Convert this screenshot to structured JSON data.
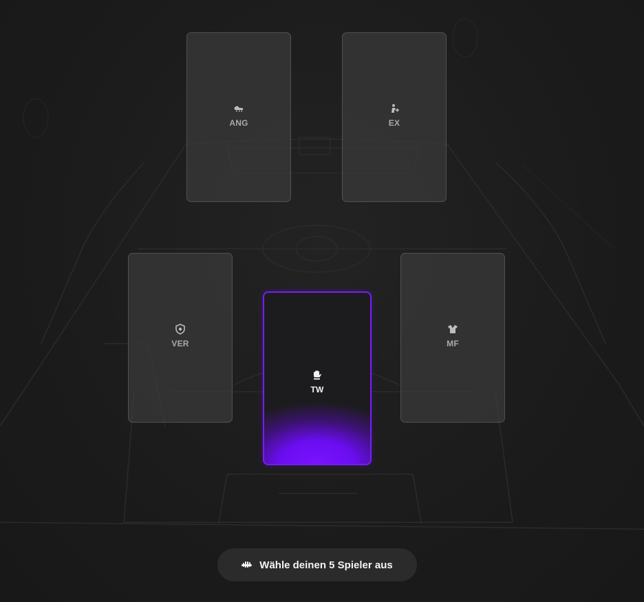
{
  "positions": {
    "ang": {
      "label": "ANG",
      "icon": "cleat-icon"
    },
    "ex": {
      "label": "EX",
      "icon": "player-plus-icon"
    },
    "ver": {
      "label": "VER",
      "icon": "shield-icon"
    },
    "tw": {
      "label": "TW",
      "icon": "glove-icon",
      "selected": true
    },
    "mf": {
      "label": "MF",
      "icon": "jersey-icon"
    }
  },
  "cta": {
    "label": "Wähle deinen 5 Spieler aus",
    "icon": "hand-icon"
  },
  "colors": {
    "accent": "#7a1cff",
    "card_bg": "#3a3a3a",
    "background": "#1c1c1c"
  }
}
